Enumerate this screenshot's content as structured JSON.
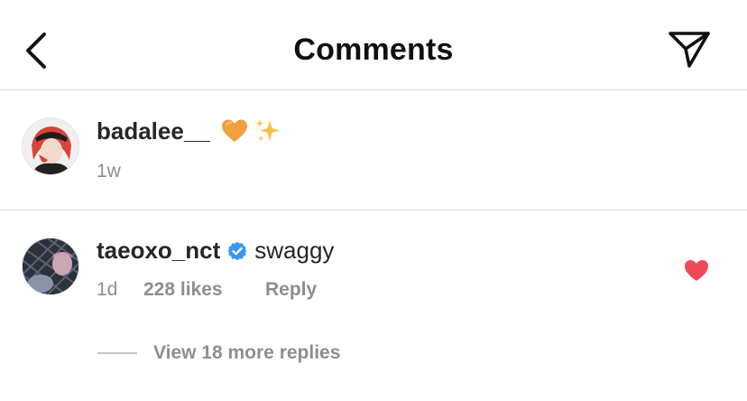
{
  "header": {
    "title": "Comments",
    "back_icon": "chevron-left-icon",
    "share_icon": "paper-plane-icon"
  },
  "caption": {
    "username": "badalee__",
    "emoji_1": "orange-heart-icon",
    "emoji_2": "sparkles-icon",
    "time": "1w"
  },
  "comment": {
    "username": "taeoxo_nct",
    "verified_icon": "verified-badge-icon",
    "text": "swaggy",
    "time": "1d",
    "likes": "228 likes",
    "reply_label": "Reply",
    "liked": true,
    "like_color": "#ed4956",
    "view_replies": "View 18 more replies"
  },
  "colors": {
    "primary_text": "#262626",
    "secondary_text": "#8e8e8e",
    "divider": "#dbdbdb",
    "verified": "#3897f0",
    "heart_orange": "#f0a03c"
  }
}
